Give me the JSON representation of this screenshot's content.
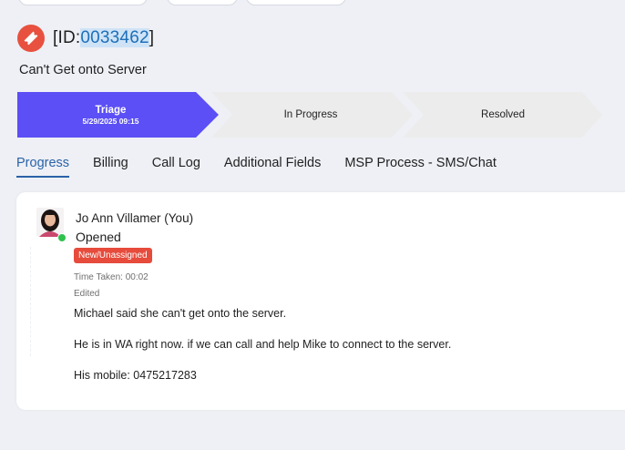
{
  "ticket": {
    "id_prefix": "[ID:",
    "id_number": "0033462",
    "id_suffix": "]",
    "subject": "Can't Get onto Server"
  },
  "pipeline": {
    "stages": [
      {
        "name": "Triage",
        "date": "5/29/2025 09:15",
        "active": true
      },
      {
        "name": "In Progress",
        "date": "",
        "active": false
      },
      {
        "name": "Resolved",
        "date": "",
        "active": false
      }
    ],
    "colors": {
      "active": "#5b4ff5",
      "inactive": "#ececec"
    }
  },
  "tabs": [
    {
      "label": "Progress",
      "active": true
    },
    {
      "label": "Billing",
      "active": false
    },
    {
      "label": "Call Log",
      "active": false
    },
    {
      "label": "Additional Fields",
      "active": false
    },
    {
      "label": "MSP Process - SMS/Chat",
      "active": false
    }
  ],
  "entry": {
    "author": "Jo Ann Villamer (You)",
    "action": "Opened",
    "status_badge": "New/Unassigned",
    "time_taken": "Time Taken: 00:02",
    "edited": "Edited",
    "notes": [
      "Michael said she can't get onto the server.",
      "He is in WA right now. if we can call and help Mike to connect to the server.",
      "His mobile: 0475217283"
    ],
    "presence": "online"
  },
  "icons": {
    "ticket": "ticket-icon",
    "avatar": "user-avatar",
    "presence": "online-status-dot"
  },
  "colors": {
    "accent": "#2a62a8",
    "ticket_icon": "#e8513f",
    "badge": "#e64b3c",
    "online": "#2fc24c"
  }
}
